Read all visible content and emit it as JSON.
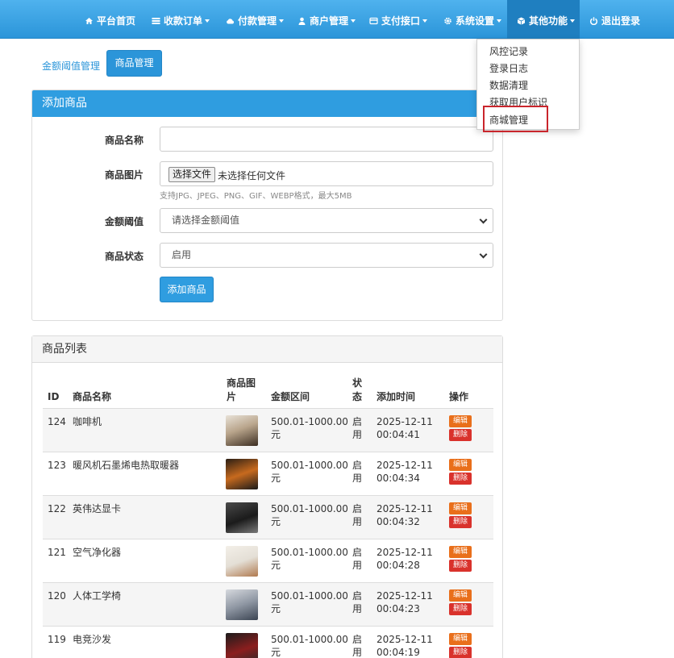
{
  "nav": {
    "items": [
      {
        "label": "平台首页",
        "icon": "home-icon",
        "caret": false
      },
      {
        "label": "收款订单",
        "icon": "list-icon",
        "caret": true
      },
      {
        "label": "付款管理",
        "icon": "cloud-icon",
        "caret": true
      },
      {
        "label": "商户管理",
        "icon": "user-icon",
        "caret": true
      },
      {
        "label": "支付接口",
        "icon": "card-icon",
        "caret": true
      },
      {
        "label": "系统设置",
        "icon": "gear-icon",
        "caret": true
      },
      {
        "label": "其他功能",
        "icon": "cube-icon",
        "caret": true
      },
      {
        "label": "退出登录",
        "icon": "power-icon",
        "caret": false
      }
    ]
  },
  "dropdown": {
    "items": [
      "风控记录",
      "登录日志",
      "数据清理",
      "获取用户标识",
      "商城管理"
    ]
  },
  "subtabs": {
    "link": "金额阈值管理",
    "active": "商品管理"
  },
  "add_panel": {
    "title": "添加商品",
    "name_label": "商品名称",
    "name_value": "",
    "image_label": "商品图片",
    "file_button": "选择文件",
    "file_status": "未选择任何文件",
    "file_help": "支持JPG、JPEG、PNG、GIF、WEBP格式，最大5MB",
    "threshold_label": "金额阈值",
    "threshold_value": "请选择金额阈值",
    "status_label": "商品状态",
    "status_value": "启用",
    "submit": "添加商品"
  },
  "list_panel": {
    "title": "商品列表",
    "headers": {
      "id": "ID",
      "name": "商品名称",
      "image_l1": "商品图",
      "image_l2": "片",
      "range": "金额区间",
      "status_l1": "状",
      "status_l2": "态",
      "time": "添加时间",
      "ops": "操作"
    },
    "rows": [
      {
        "id": "124",
        "name": "咖啡机",
        "range_l1": "500.01-1000.00",
        "range_l2": "元",
        "status_l1": "启",
        "status_l2": "用",
        "date": "2025-12-11",
        "time": "00:04:41",
        "edit": "编辑",
        "del": "删除"
      },
      {
        "id": "123",
        "name": "暖风机石墨烯电热取暖器",
        "range_l1": "500.01-1000.00",
        "range_l2": "元",
        "status_l1": "启",
        "status_l2": "用",
        "date": "2025-12-11",
        "time": "00:04:34",
        "edit": "编辑",
        "del": "删除"
      },
      {
        "id": "122",
        "name": "英伟达显卡",
        "range_l1": "500.01-1000.00",
        "range_l2": "元",
        "status_l1": "启",
        "status_l2": "用",
        "date": "2025-12-11",
        "time": "00:04:32",
        "edit": "编辑",
        "del": "删除"
      },
      {
        "id": "121",
        "name": "空气净化器",
        "range_l1": "500.01-1000.00",
        "range_l2": "元",
        "status_l1": "启",
        "status_l2": "用",
        "date": "2025-12-11",
        "time": "00:04:28",
        "edit": "编辑",
        "del": "删除"
      },
      {
        "id": "120",
        "name": "人体工学椅",
        "range_l1": "500.01-1000.00",
        "range_l2": "元",
        "status_l1": "启",
        "status_l2": "用",
        "date": "2025-12-11",
        "time": "00:04:23",
        "edit": "编辑",
        "del": "删除"
      },
      {
        "id": "119",
        "name": "电竞沙发",
        "range_l1": "500.01-1000.00",
        "range_l2": "元",
        "status_l1": "启",
        "status_l2": "用",
        "date": "2025-12-11",
        "time": "00:04:19",
        "edit": "编辑",
        "del": "删除"
      }
    ]
  },
  "colors": {
    "nav": "#2b95d9",
    "active_nav": "#1f7fc0",
    "edit": "#e96f1b",
    "delete": "#d9322c",
    "highlight": "#c9252c"
  }
}
